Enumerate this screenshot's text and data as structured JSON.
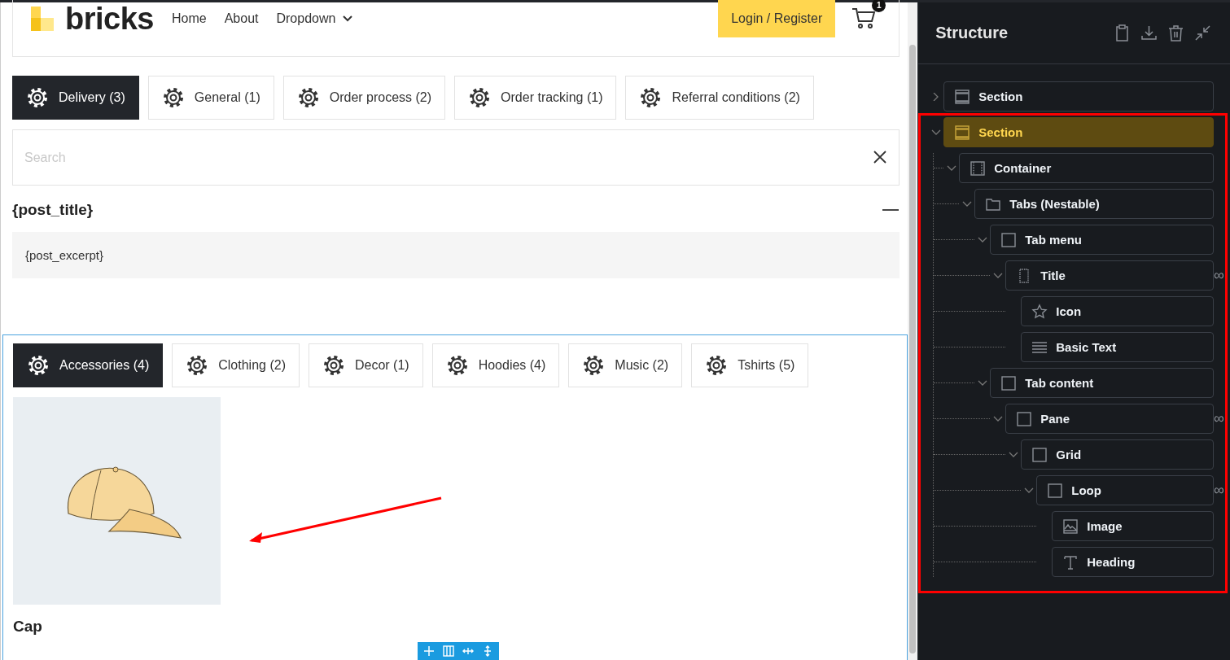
{
  "header": {
    "logo": "bricks",
    "nav": [
      {
        "label": "Home",
        "dropdown": false
      },
      {
        "label": "About",
        "dropdown": false
      },
      {
        "label": "Dropdown",
        "dropdown": true
      }
    ],
    "login_button": "Login / Register",
    "cart_count": "1"
  },
  "tabs_top": [
    {
      "label": "Delivery (3)",
      "selected": true
    },
    {
      "label": "General (1)",
      "selected": false
    },
    {
      "label": "Order process (2)",
      "selected": false
    },
    {
      "label": "Order tracking (1)",
      "selected": false
    },
    {
      "label": "Referral conditions (2)",
      "selected": false
    }
  ],
  "search": {
    "placeholder": "Search"
  },
  "accordion": {
    "title": "{post_title}",
    "expanded": true,
    "content": "{post_excerpt}"
  },
  "tabs_bottom": [
    {
      "label": "Accessories (4)",
      "selected": true
    },
    {
      "label": "Clothing (2)",
      "selected": false
    },
    {
      "label": "Decor (1)",
      "selected": false
    },
    {
      "label": "Hoodies (4)",
      "selected": false
    },
    {
      "label": "Music (2)",
      "selected": false
    },
    {
      "label": "Tshirts (5)",
      "selected": false
    }
  ],
  "product": {
    "heading": "Cap"
  },
  "structure": {
    "title": "Structure",
    "loop_mark": "∞",
    "tree": [
      {
        "label": "Section",
        "kind": "section",
        "expanded": false,
        "selected": false,
        "loop": false
      },
      {
        "label": "Section",
        "kind": "section",
        "expanded": true,
        "selected": true,
        "loop": false,
        "children": [
          {
            "label": "Container",
            "kind": "container",
            "expanded": true,
            "selected": false,
            "loop": false,
            "children": [
              {
                "label": "Tabs (Nestable)",
                "kind": "tabs",
                "expanded": true,
                "selected": false,
                "loop": false,
                "children": [
                  {
                    "label": "Tab menu",
                    "kind": "block",
                    "expanded": true,
                    "selected": false,
                    "loop": false,
                    "children": [
                      {
                        "label": "Title",
                        "kind": "div",
                        "expanded": true,
                        "selected": false,
                        "loop": true,
                        "children": [
                          {
                            "label": "Icon",
                            "kind": "icon",
                            "selected": false,
                            "loop": false
                          },
                          {
                            "label": "Basic Text",
                            "kind": "text",
                            "selected": false,
                            "loop": false
                          }
                        ]
                      }
                    ]
                  },
                  {
                    "label": "Tab content",
                    "kind": "block",
                    "expanded": true,
                    "selected": false,
                    "loop": false,
                    "children": [
                      {
                        "label": "Pane",
                        "kind": "block",
                        "expanded": true,
                        "selected": false,
                        "loop": true,
                        "children": [
                          {
                            "label": "Grid",
                            "kind": "block",
                            "expanded": true,
                            "selected": false,
                            "loop": false,
                            "children": [
                              {
                                "label": "Loop",
                                "kind": "block",
                                "expanded": true,
                                "selected": false,
                                "loop": true,
                                "children": [
                                  {
                                    "label": "Image",
                                    "kind": "image",
                                    "selected": false,
                                    "loop": false
                                  },
                                  {
                                    "label": "Heading",
                                    "kind": "heading",
                                    "selected": false,
                                    "loop": false
                                  }
                                ]
                              }
                            ]
                          }
                        ]
                      }
                    ]
                  }
                ]
              }
            ]
          }
        ]
      }
    ]
  }
}
